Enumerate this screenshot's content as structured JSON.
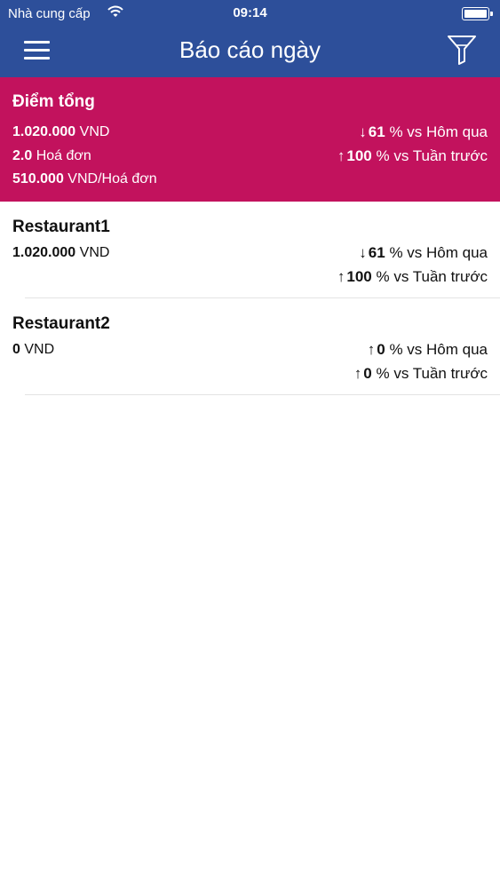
{
  "status_bar": {
    "carrier": "Nhà cung cấp",
    "time": "09:14"
  },
  "nav": {
    "title": "Báo cáo ngày"
  },
  "summary": {
    "title": "Điểm tổng",
    "revenue_value": "1.020.000",
    "revenue_unit": "VND",
    "invoices_value": "2.0",
    "invoices_unit": "Hoá đơn",
    "avg_value": "510.000",
    "avg_unit": "VND/Hoá đơn",
    "vs_yesterday": {
      "arrow": "↓",
      "value": "61",
      "text": "% vs Hôm qua"
    },
    "vs_last_week": {
      "arrow": "↑",
      "value": "100",
      "text": "% vs Tuần trước"
    }
  },
  "restaurants": [
    {
      "name": "Restaurant1",
      "revenue_value": "1.020.000",
      "revenue_unit": "VND",
      "vs_yesterday": {
        "arrow": "↓",
        "value": "61",
        "text": "% vs Hôm qua"
      },
      "vs_last_week": {
        "arrow": "↑",
        "value": "100",
        "text": "% vs Tuần trước"
      }
    },
    {
      "name": "Restaurant2",
      "revenue_value": "0",
      "revenue_unit": "VND",
      "vs_yesterday": {
        "arrow": "↑",
        "value": "0",
        "text": "% vs Hôm qua"
      },
      "vs_last_week": {
        "arrow": "↑",
        "value": "0",
        "text": "% vs Tuần trước"
      }
    }
  ],
  "colors": {
    "nav": "#2d4f9a",
    "summary": "#c2125d",
    "divider": "#e3e3e3"
  },
  "icons": {
    "menu": "hamburger-icon",
    "filter": "funnel-icon",
    "wifi": "wifi-icon",
    "battery": "battery-icon"
  }
}
